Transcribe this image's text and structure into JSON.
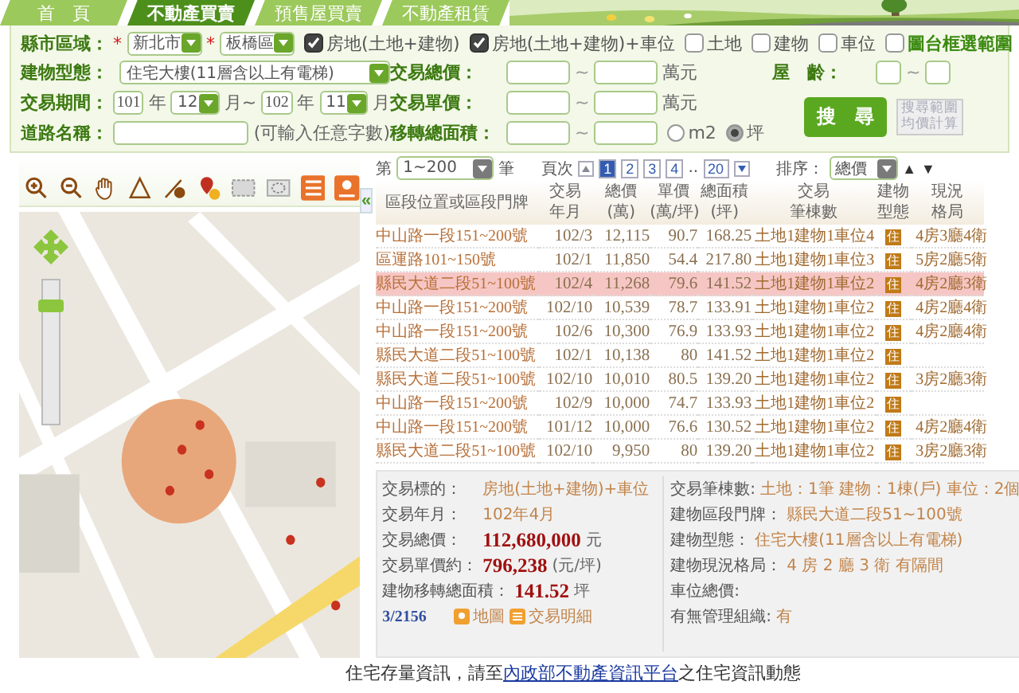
{
  "nav_tabs": [
    {
      "label": "首　頁",
      "selected": false
    },
    {
      "label": "不動產買賣",
      "selected": true
    },
    {
      "label": "預售屋買賣",
      "selected": false
    },
    {
      "label": "不動產租賃",
      "selected": false
    }
  ],
  "search": {
    "city_label": "縣市區域：",
    "required_mark": "*",
    "city": "新北市",
    "district_mark": "*",
    "district": "板橋區",
    "types": [
      {
        "label": "房地(土地+建物)",
        "checked": true
      },
      {
        "label": "房地(土地+建物)+車位",
        "checked": true
      },
      {
        "label": "土地",
        "checked": false
      },
      {
        "label": "建物",
        "checked": false
      },
      {
        "label": "車位",
        "checked": false
      }
    ],
    "map_range": {
      "label": "圖台框選範圍",
      "checked": false
    },
    "building_type_label": "建物型態：",
    "building_type": "住宅大樓(11層含以上有電梯)",
    "period_label": "交易期間：",
    "from_year": "101",
    "from_year_unit": "年",
    "from_month": "12",
    "from_month_unit": "月~",
    "to_year": "102",
    "to_year_unit": "年",
    "to_month": "11",
    "to_month_unit": "月",
    "road_label": "道路名稱：",
    "road_hint": "(可輸入任意字數)",
    "ranges": [
      {
        "label": "交易總價：",
        "sep": "~",
        "unit": "萬元"
      },
      {
        "label": "交易單價：",
        "sep": "~",
        "unit": "萬元"
      },
      {
        "label": "移轉總面積：",
        "sep": "~"
      }
    ],
    "area_units": [
      {
        "label": "m2",
        "selected": false
      },
      {
        "label": "坪",
        "selected": true
      }
    ],
    "age": {
      "label": "屋　齡：",
      "sep": "~"
    },
    "search_button": "搜　尋",
    "average_button": {
      "lines": [
        "搜尋範圍",
        "均價計算"
      ],
      "disabled": true
    }
  },
  "map_zoom": {
    "level": 0.85
  },
  "pager": {
    "prefix": "第",
    "range": "1~200",
    "suffix": "筆",
    "page_label": "頁次",
    "pages": [
      {
        "kind": "page",
        "label": "1",
        "selected": true
      },
      {
        "kind": "page",
        "label": "2",
        "selected": false
      },
      {
        "kind": "page",
        "label": "3",
        "selected": false
      },
      {
        "kind": "page",
        "label": "4",
        "selected": false
      },
      {
        "kind": "gap",
        "label": ".."
      },
      {
        "kind": "page",
        "label": "20",
        "selected": false
      }
    ],
    "sort_label": "排序：",
    "sort": "總價",
    "sort_arrows": [
      "▲",
      "▼"
    ]
  },
  "collapse": "«",
  "table": {
    "columns": [
      {
        "lines": [
          "區段位置或區段門牌"
        ]
      },
      {
        "lines": [
          "交易",
          "年月"
        ]
      },
      {
        "lines": [
          "總價",
          "(萬)"
        ]
      },
      {
        "lines": [
          "單價",
          "(萬/坪)"
        ]
      },
      {
        "lines": [
          "總面積",
          "(坪)"
        ]
      },
      {
        "lines": [
          "交易",
          "筆棟數"
        ]
      },
      {
        "lines": [
          "建物",
          "型態"
        ]
      },
      {
        "lines": [
          "現況",
          "格局"
        ]
      }
    ],
    "rows": [
      {
        "selected": false,
        "cells": [
          "中山路一段151~200號",
          "102/3",
          "12,115",
          "90.7",
          "168.25",
          "土地1建物1車位4",
          "住",
          "4房3廳4衛"
        ]
      },
      {
        "selected": false,
        "cells": [
          "區運路101~150號",
          "102/1",
          "11,850",
          "54.4",
          "217.80",
          "土地1建物1車位3",
          "住",
          "5房2廳5衛"
        ]
      },
      {
        "selected": true,
        "cells": [
          "縣民大道二段51~100號",
          "102/4",
          "11,268",
          "79.6",
          "141.52",
          "土地1建物1車位2",
          "住",
          "4房2廳3衛"
        ]
      },
      {
        "selected": false,
        "cells": [
          "中山路一段151~200號",
          "102/10",
          "10,539",
          "78.7",
          "133.91",
          "土地1建物1車位2",
          "住",
          "4房2廳4衛"
        ]
      },
      {
        "selected": false,
        "cells": [
          "中山路一段151~200號",
          "102/6",
          "10,300",
          "76.9",
          "133.93",
          "土地1建物1車位2",
          "住",
          "4房2廳4衛"
        ]
      },
      {
        "selected": false,
        "cells": [
          "縣民大道二段51~100號",
          "102/1",
          "10,138",
          "80",
          "141.52",
          "土地1建物1車位2",
          "住",
          ""
        ]
      },
      {
        "selected": false,
        "cells": [
          "縣民大道二段51~100號",
          "102/10",
          "10,010",
          "80.5",
          "139.20",
          "土地1建物1車位2",
          "住",
          "3房2廳3衛"
        ]
      },
      {
        "selected": false,
        "cells": [
          "中山路一段151~200號",
          "102/9",
          "10,000",
          "74.7",
          "133.93",
          "土地1建物1車位2",
          "住",
          ""
        ]
      },
      {
        "selected": false,
        "cells": [
          "中山路一段151~200號",
          "101/12",
          "10,000",
          "76.6",
          "130.52",
          "土地1建物1車位2",
          "住",
          "4房2廳4衛"
        ]
      },
      {
        "selected": false,
        "cells": [
          "縣民大道二段51~100號",
          "102/10",
          "9,950",
          "80",
          "139.20",
          "土地1建物1車位2",
          "住",
          "3房2廳3衛"
        ]
      }
    ]
  },
  "details": {
    "left": [
      {
        "kind": "text",
        "label": "交易標的：",
        "value": "房地(土地+建物)+車位"
      },
      {
        "kind": "text",
        "label": "交易年月：",
        "value": "102年4月"
      },
      {
        "kind": "amount",
        "label": "交易總價：",
        "value": "112,680,000",
        "unit": "元"
      },
      {
        "kind": "amount",
        "label": "交易單價約：",
        "value": "796,238",
        "unit": "(元/坪)"
      },
      {
        "kind": "amount",
        "label": "建物移轉總面積：",
        "value": "141.52",
        "unit": "坪"
      }
    ],
    "right": [
      {
        "label": "交易筆棟數:",
        "value": "土地：1筆 建物：1棟(戶) 車位：2個"
      },
      {
        "label": "建物區段門牌：",
        "value": "縣民大道二段51~100號"
      },
      {
        "label": "建物型態：",
        "value": "住宅大樓(11層含以上有電梯)"
      },
      {
        "label": "建物現況格局：",
        "value": "4 房 2 廳 3 衛 有隔間"
      },
      {
        "label": "車位總價:"
      },
      {
        "label": "有無管理組織:",
        "value": "有"
      }
    ],
    "counter": "3/2156",
    "map_button": "地圖",
    "detail_button": "交易明細"
  },
  "notice": {
    "before": "住宅存量資訊，請至",
    "link": "內政部不動產資訊平台",
    "after": "之住宅資訊動態"
  }
}
